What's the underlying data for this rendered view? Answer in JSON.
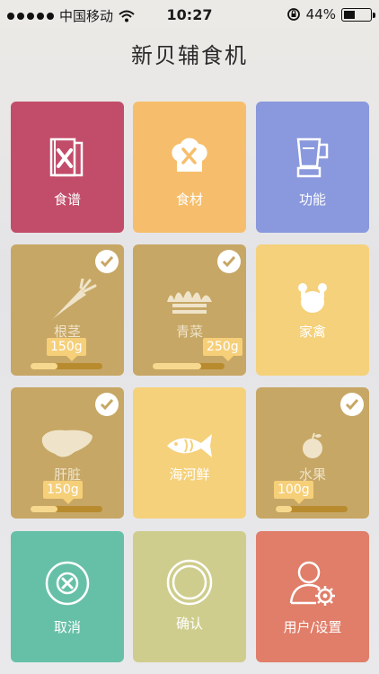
{
  "status": {
    "carrier": "中国移动",
    "time": "10:27",
    "battery": "44%",
    "battery_level": 0.44
  },
  "app": {
    "title": "新贝辅食机"
  },
  "colors": {
    "recipe": "#c24d6a",
    "ingredient": "#f6be6c",
    "function": "#8a99dd",
    "selected": "#c7a765",
    "unselected": "#f5d17b",
    "cancel": "#66c0a7",
    "confirm": "#cfcd8d",
    "user": "#e07e69"
  },
  "menu": {
    "recipe": {
      "label": "食谱",
      "icon": "recipe-book-icon"
    },
    "ingredient": {
      "label": "食材",
      "icon": "chef-hat-icon"
    },
    "function": {
      "label": "功能",
      "icon": "blender-icon"
    }
  },
  "ingredients": {
    "root": {
      "label": "根茎",
      "amount": "150g",
      "selected": true,
      "level": 0.38,
      "icon": "carrot-icon"
    },
    "greens": {
      "label": "青菜",
      "amount": "250g",
      "selected": true,
      "level": 0.68,
      "icon": "leafy-greens-icon"
    },
    "poultry": {
      "label": "家禽",
      "selected": false,
      "icon": "chicken-icon"
    },
    "liver": {
      "label": "肝脏",
      "amount": "150g",
      "selected": true,
      "level": 0.38,
      "icon": "liver-icon"
    },
    "seafood": {
      "label": "海河鲜",
      "selected": false,
      "icon": "fish-icon"
    },
    "fruit": {
      "label": "水果",
      "amount": "100g",
      "selected": true,
      "level": 0.22,
      "icon": "apple-icon"
    }
  },
  "actions": {
    "cancel": {
      "label": "取消",
      "icon": "cancel-icon"
    },
    "confirm": {
      "label": "确认",
      "icon": "confirm-circle-icon"
    },
    "user": {
      "label": "用户/设置",
      "icon": "user-settings-icon"
    }
  }
}
